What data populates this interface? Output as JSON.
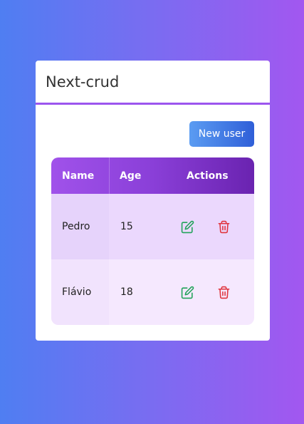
{
  "app": {
    "title": "Next-crud"
  },
  "toolbar": {
    "new_user_label": "New user"
  },
  "table": {
    "headers": [
      "Name",
      "Age",
      "Actions"
    ],
    "rows": [
      {
        "name": "Pedro",
        "age": "15"
      },
      {
        "name": "Flávio",
        "age": "18"
      }
    ]
  },
  "icons": {
    "edit": "edit-icon",
    "delete": "trash-icon"
  },
  "colors": {
    "accent": "#9c55ee",
    "edit": "#22a35a",
    "delete": "#e0353d",
    "button_start": "#5b9cf2",
    "button_end": "#2f5fd8"
  }
}
